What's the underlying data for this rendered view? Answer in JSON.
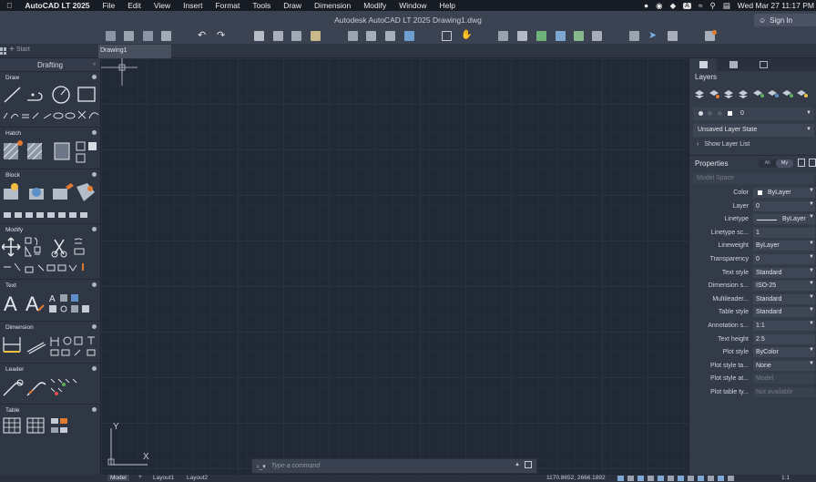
{
  "menubar": {
    "app_name": "AutoCAD LT 2025",
    "items": [
      "File",
      "Edit",
      "View",
      "Insert",
      "Format",
      "Tools",
      "Draw",
      "Dimension",
      "Modify",
      "Window",
      "Help"
    ],
    "datetime": "Wed Mar 27  11:17 PM"
  },
  "window": {
    "title": "Autodesk AutoCAD LT 2025   Drawing1.dwg",
    "sign_in": "Sign In"
  },
  "tabs": {
    "start": "Start",
    "drawing": "Drawing1"
  },
  "palette": {
    "title": "Drafting",
    "sections": [
      "Draw",
      "Hatch",
      "Block",
      "Modify",
      "Text",
      "Dimension",
      "Leader",
      "Table"
    ]
  },
  "command_line": {
    "prompt_icon": "x-icon",
    "placeholder": "Type a command"
  },
  "layers_panel": {
    "title": "Layers",
    "current_layer": "0",
    "layer_state": "Unsaved Layer State",
    "show_list": "Show Layer List"
  },
  "properties_panel": {
    "title": "Properties",
    "filter_all": "All",
    "filter_my": "My",
    "space": "Model Space",
    "rows": [
      {
        "label": "Color",
        "value": "ByLayer"
      },
      {
        "label": "Layer",
        "value": "0"
      },
      {
        "label": "Linetype",
        "value": "ByLayer"
      },
      {
        "label": "Linetype sc...",
        "value": "1"
      },
      {
        "label": "Lineweight",
        "value": "ByLayer"
      },
      {
        "label": "Transparency",
        "value": "0"
      },
      {
        "label": "Text style",
        "value": "Standard"
      },
      {
        "label": "Dimension s...",
        "value": "ISO-25"
      },
      {
        "label": "Multileader...",
        "value": "Standard"
      },
      {
        "label": "Table style",
        "value": "Standard"
      },
      {
        "label": "Annotation s...",
        "value": "1:1"
      },
      {
        "label": "Text height",
        "value": "2.5"
      },
      {
        "label": "Plot style",
        "value": "ByColor"
      },
      {
        "label": "Plot style ta...",
        "value": "None"
      },
      {
        "label": "Plot style at...",
        "value": "Model"
      },
      {
        "label": "Plot table ty...",
        "value": "Not available"
      }
    ]
  },
  "ucs": {
    "x": "X",
    "y": "Y"
  },
  "status_bar": {
    "tabs": [
      "Model",
      "Layout1",
      "Layout2"
    ],
    "coords": "1170.8652, 2666.1892",
    "scale": "1:1"
  },
  "colors": {
    "canvas": "#212836",
    "panel": "#333a48",
    "accent_orange": "#e07a2e"
  }
}
